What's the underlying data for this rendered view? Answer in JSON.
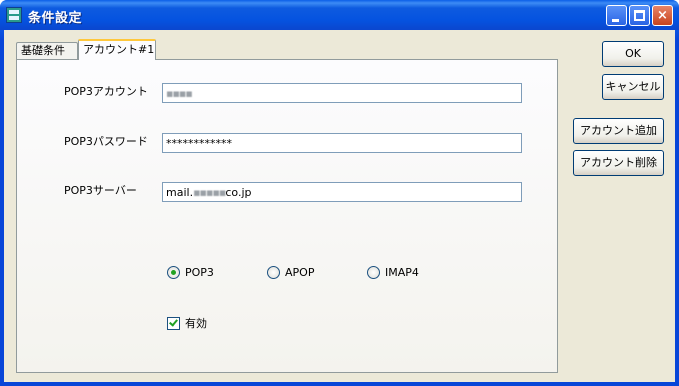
{
  "window": {
    "title": "条件設定",
    "controls": {
      "minimize": "minimize-icon",
      "maximize": "maximize-icon",
      "close": "×"
    }
  },
  "tabs": [
    {
      "label": "基礎条件",
      "active": false
    },
    {
      "label": "アカウント#1",
      "active": true
    }
  ],
  "form": {
    "account_label": "POP3アカウント",
    "account_value": "",
    "password_label": "POP3パスワード",
    "password_value": "************",
    "server_label": "POP3サーバー",
    "server_value_prefix": "mail.",
    "server_value_suffix": "co.jp",
    "protocol": {
      "options": [
        "POP3",
        "APOP",
        "IMAP4"
      ],
      "selected": "POP3"
    },
    "enabled_label": "有効",
    "enabled_checked": true
  },
  "buttons": {
    "ok": "OK",
    "cancel": "キャンセル",
    "add_account": "アカウント追加",
    "delete_account": "アカウント削除"
  },
  "colors": {
    "titlebar": "#0a54e3",
    "client_bg": "#ece9d8",
    "close_button": "#c8431d",
    "active_tab_accent": "#ffc83c",
    "radio_check_green": "#21a121"
  }
}
